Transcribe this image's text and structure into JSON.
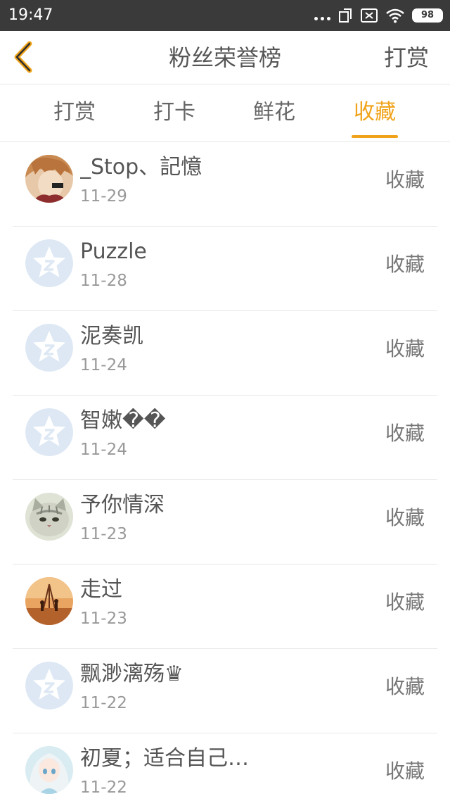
{
  "status": {
    "time": "19:47",
    "battery": "98"
  },
  "header": {
    "title": "粉丝荣誉榜",
    "right_action": "打赏"
  },
  "tabs": [
    {
      "label": "打赏",
      "active": false
    },
    {
      "label": "打卡",
      "active": false
    },
    {
      "label": "鲜花",
      "active": false
    },
    {
      "label": "收藏",
      "active": true
    }
  ],
  "fans": [
    {
      "name": "_Stop、記憶",
      "date": "11-29",
      "action": "收藏",
      "avatar": "photo-anime-boy"
    },
    {
      "name": "Puzzle",
      "date": "11-28",
      "action": "收藏",
      "avatar": "default-star"
    },
    {
      "name": "泥奏凯",
      "date": "11-24",
      "action": "收藏",
      "avatar": "default-star"
    },
    {
      "name": "智嫩��",
      "date": "11-24",
      "action": "收藏",
      "avatar": "default-star"
    },
    {
      "name": "予你情深",
      "date": "11-23",
      "action": "收藏",
      "avatar": "photo-cat"
    },
    {
      "name": "走过",
      "date": "11-23",
      "action": "收藏",
      "avatar": "photo-sunset"
    },
    {
      "name": "飘渺漓殇♛",
      "date": "11-22",
      "action": "收藏",
      "avatar": "default-star"
    },
    {
      "name": "初夏；适合自己…",
      "date": "11-22",
      "action": "收藏",
      "avatar": "photo-anime-girl"
    }
  ],
  "colors": {
    "accent": "#f0a31a",
    "status_bar": "#3a3a3a"
  }
}
